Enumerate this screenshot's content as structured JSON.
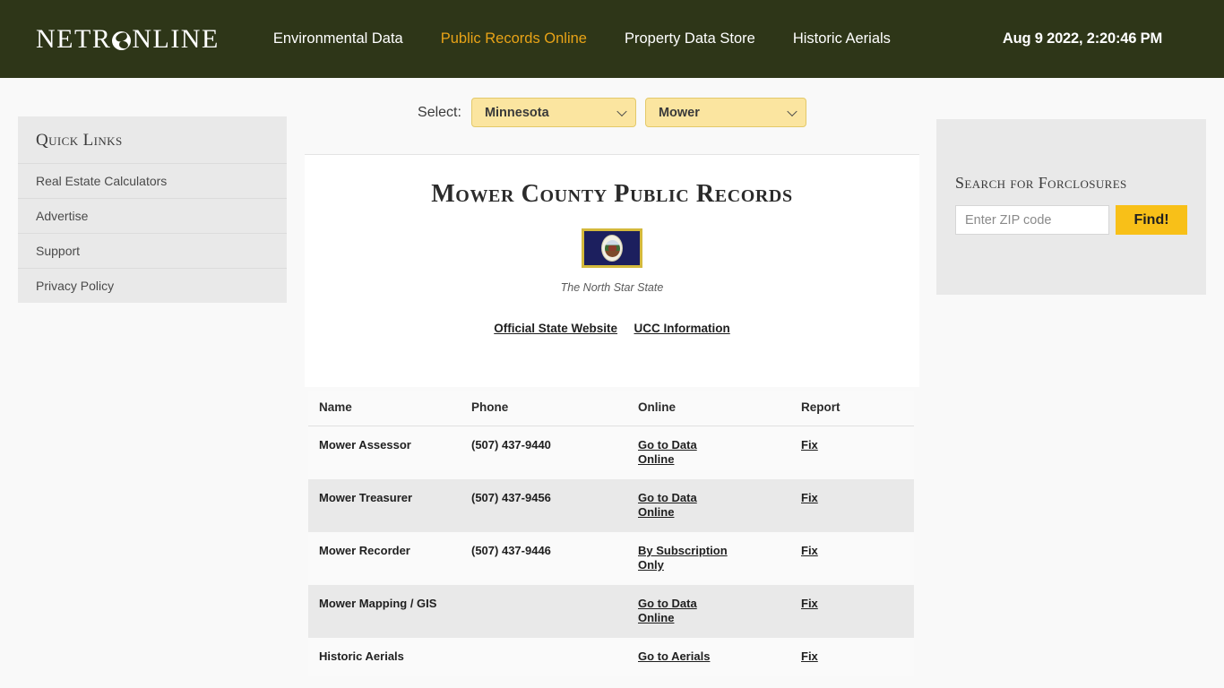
{
  "header": {
    "logo_text_before": "NETR",
    "logo_icon": "globe-icon",
    "logo_text_after": "NLINE",
    "nav": [
      {
        "label": "Environmental Data",
        "active": false
      },
      {
        "label": "Public Records Online",
        "active": true
      },
      {
        "label": "Property Data Store",
        "active": false
      },
      {
        "label": "Historic Aerials",
        "active": false
      }
    ],
    "clock": "Aug 9 2022, 2:20:46 PM",
    "bg_color": "#2e3618",
    "active_color": "#e8a317"
  },
  "sidebar_left": {
    "title": "Quick Links",
    "items": [
      {
        "label": "Real Estate Calculators"
      },
      {
        "label": "Advertise"
      },
      {
        "label": "Support"
      },
      {
        "label": "Privacy Policy"
      }
    ]
  },
  "selectors": {
    "label": "Select:",
    "state": {
      "value": "Minnesota",
      "options": [
        "Minnesota"
      ]
    },
    "county": {
      "value": "Mower",
      "options": [
        "Mower"
      ]
    },
    "bg_color": "#fbe5a0"
  },
  "card": {
    "title": "Mower County Public Records",
    "flag_alt": "minnesota-state-flag",
    "flag_caption": "The North Star State",
    "links": [
      {
        "label": "Official State Website"
      },
      {
        "label": "UCC Information"
      }
    ]
  },
  "table": {
    "columns": [
      "Name",
      "Phone",
      "Online",
      "Report"
    ],
    "rows": [
      {
        "name": "Mower Assessor",
        "phone": "(507) 437-9440",
        "online": "Go to Data Online",
        "report": "Fix"
      },
      {
        "name": "Mower Treasurer",
        "phone": "(507) 437-9456",
        "online": "Go to Data Online",
        "report": "Fix"
      },
      {
        "name": "Mower Recorder",
        "phone": "(507) 437-9446",
        "online": "By Subscription Only",
        "report": "Fix"
      },
      {
        "name": "Mower Mapping / GIS",
        "phone": "",
        "online": "Go to Data Online",
        "report": "Fix"
      },
      {
        "name": "Historic Aerials",
        "phone": "",
        "online": "Go to Aerials",
        "report": "Fix"
      }
    ]
  },
  "sidebar_right": {
    "title": "Search for Forclosures",
    "zip_placeholder": "Enter ZIP code",
    "zip_value": "",
    "find_label": "Find!",
    "find_color": "#f8c018"
  }
}
